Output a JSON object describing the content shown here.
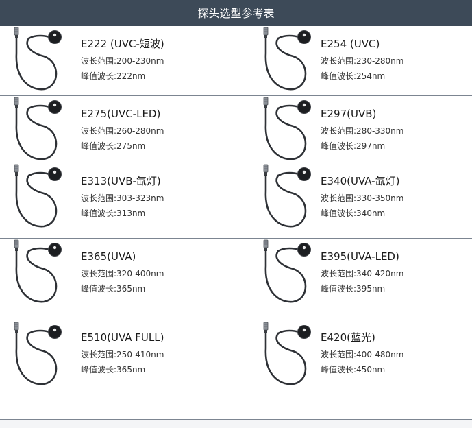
{
  "header": {
    "title": "探头选型参考表"
  },
  "labels": {
    "wavelength_range": "波长范围:",
    "peak_wavelength": "峰值波长:"
  },
  "probes": [
    {
      "model": "E222 (UVC-短波)",
      "range": "200-230nm",
      "peak": "222nm"
    },
    {
      "model": "E254 (UVC)",
      "range": "230-280nm",
      "peak": "254nm"
    },
    {
      "model": "E275(UVC-LED)",
      "range": "260-280nm",
      "peak": "275nm"
    },
    {
      "model": "E297(UVB)",
      "range": "280-330nm",
      "peak": "297nm"
    },
    {
      "model": "E313(UVB-氙灯)",
      "range": "303-323nm",
      "peak": "313nm"
    },
    {
      "model": "E340(UVA-氙灯)",
      "range": "330-350nm",
      "peak": "340nm"
    },
    {
      "model": "E365(UVA)",
      "range": "320-400nm",
      "peak": "365nm"
    },
    {
      "model": "E395(UVA-LED)",
      "range": "340-420nm",
      "peak": "395nm"
    },
    {
      "model": "E510(UVA FULL)",
      "range": "250-410nm",
      "peak": "365nm"
    },
    {
      "model": "E420(蓝光)",
      "range": "400-480nm",
      "peak": "450nm"
    }
  ]
}
